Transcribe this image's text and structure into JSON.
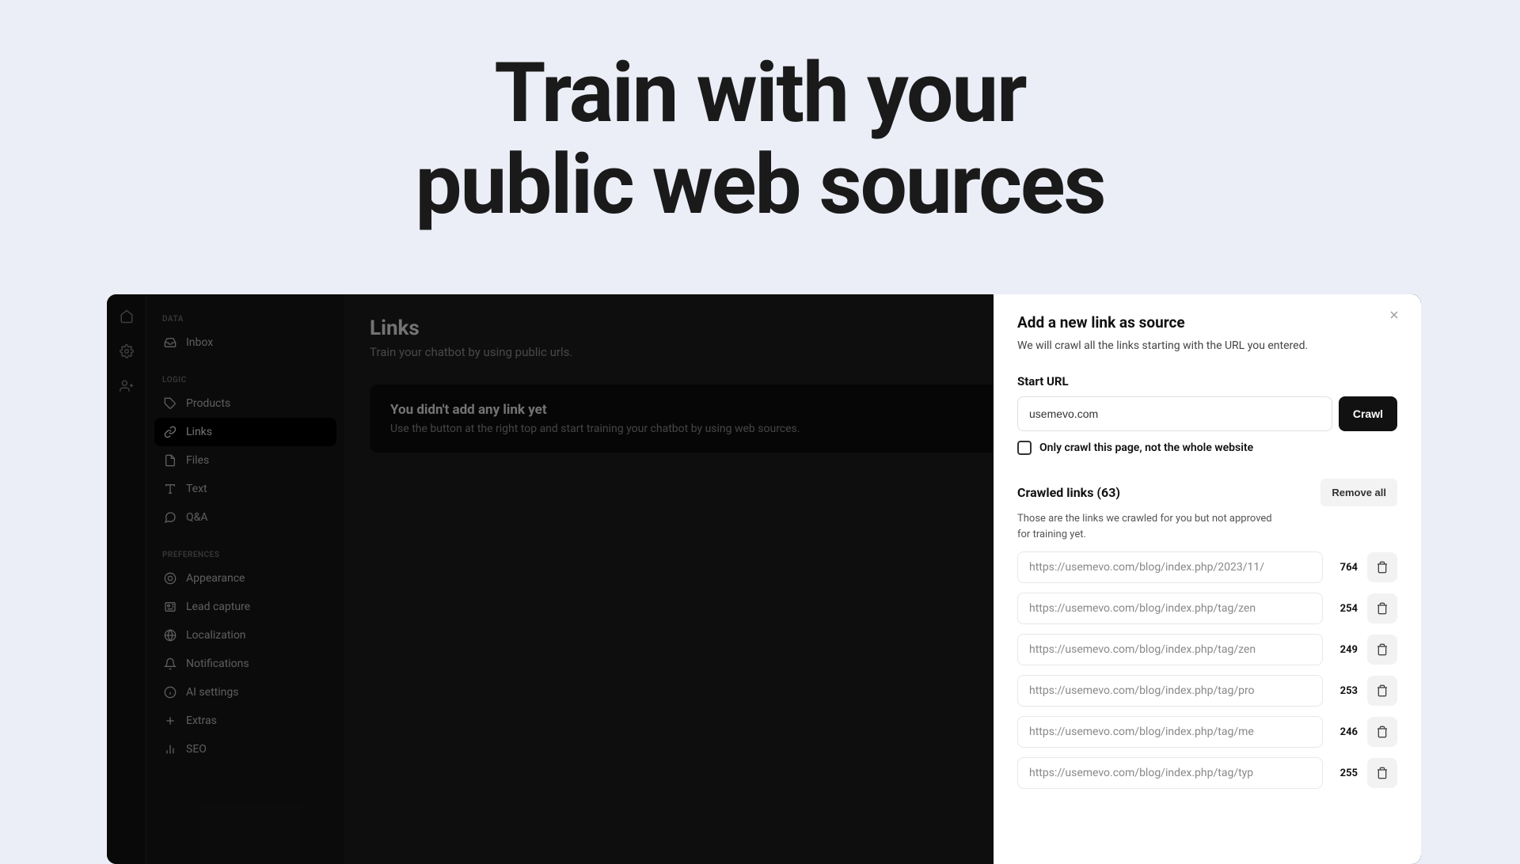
{
  "hero": {
    "line1": "Train with your",
    "line2": "public web sources"
  },
  "rail": {
    "icons": [
      "home-icon",
      "gear-icon",
      "user-plus-icon"
    ]
  },
  "sidebar": {
    "section_data": "DATA",
    "section_logic": "LOGIC",
    "section_preferences": "PREFERENCES",
    "items_data": [
      {
        "label": "Inbox",
        "icon": "inbox-icon"
      }
    ],
    "items_logic": [
      {
        "label": "Products",
        "icon": "tag-icon"
      },
      {
        "label": "Links",
        "icon": "link-icon"
      },
      {
        "label": "Files",
        "icon": "file-icon"
      },
      {
        "label": "Text",
        "icon": "text-icon"
      },
      {
        "label": "Q&A",
        "icon": "chat-icon"
      }
    ],
    "items_preferences": [
      {
        "label": "Appearance",
        "icon": "palette-icon"
      },
      {
        "label": "Lead capture",
        "icon": "id-card-icon"
      },
      {
        "label": "Localization",
        "icon": "globe-icon"
      },
      {
        "label": "Notifications",
        "icon": "bell-icon"
      },
      {
        "label": "AI settings",
        "icon": "info-icon"
      },
      {
        "label": "Extras",
        "icon": "plus-icon"
      },
      {
        "label": "SEO",
        "icon": "bars-icon"
      }
    ]
  },
  "main": {
    "title": "Links",
    "subtitle": "Train your chatbot by using public urls.",
    "empty_title": "You didn't add any link yet",
    "empty_msg": "Use the button at the right top and start training your chatbot by using web sources."
  },
  "panel": {
    "title": "Add a new link as source",
    "desc": "We will crawl all the links starting with the URL you entered.",
    "start_label": "Start URL",
    "url_value": "usemevo.com",
    "crawl_label": "Crawl",
    "checkbox_label": "Only crawl this page, not the whole website",
    "crawled_title": "Crawled links (63)",
    "remove_all": "Remove all",
    "crawled_desc": "Those are the links we crawled for you but not approved for training yet.",
    "links": [
      {
        "url": "https://usemevo.com/blog/index.php/2023/11/",
        "count": "764"
      },
      {
        "url": "https://usemevo.com/blog/index.php/tag/zen",
        "count": "254"
      },
      {
        "url": "https://usemevo.com/blog/index.php/tag/zen",
        "count": "249"
      },
      {
        "url": "https://usemevo.com/blog/index.php/tag/pro",
        "count": "253"
      },
      {
        "url": "https://usemevo.com/blog/index.php/tag/me",
        "count": "246"
      },
      {
        "url": "https://usemevo.com/blog/index.php/tag/typ",
        "count": "255"
      }
    ]
  }
}
